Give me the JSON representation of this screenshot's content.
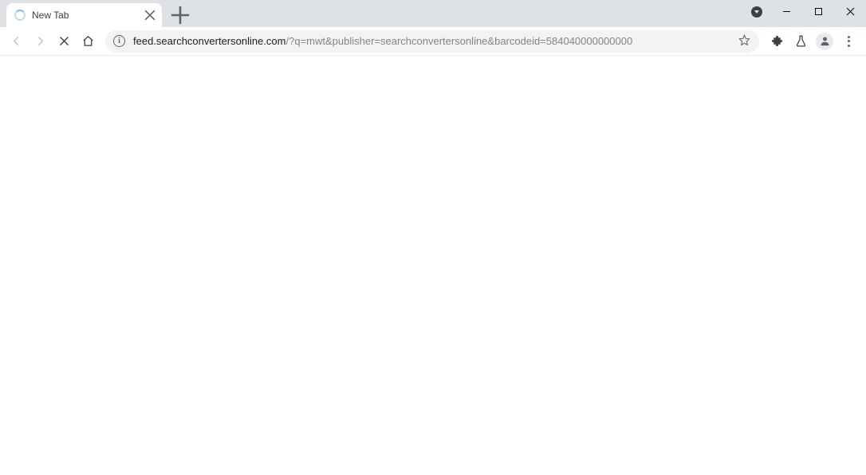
{
  "tab": {
    "title": "New Tab"
  },
  "address": {
    "host": "feed.searchconvertersonline.com",
    "path": "/?q=mwt&publisher=searchconvertersonline&barcodeid=584040000000000"
  }
}
